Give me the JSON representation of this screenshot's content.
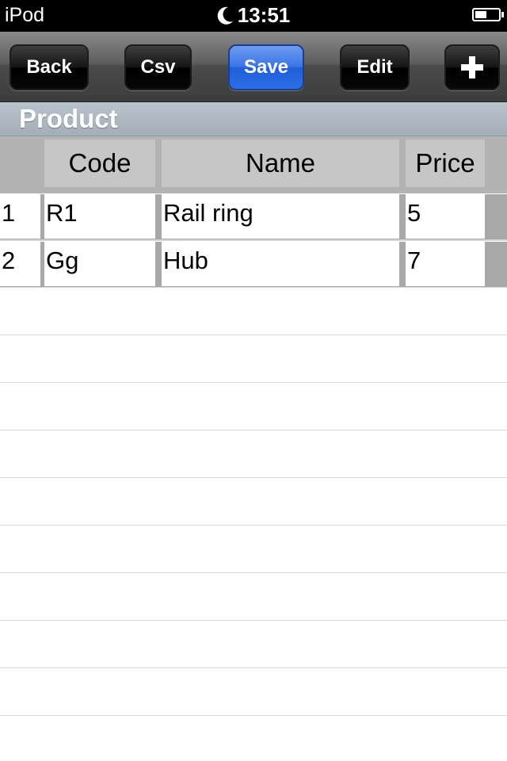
{
  "status_bar": {
    "carrier": "iPod",
    "time": "13:51",
    "battery_level": 0.5
  },
  "toolbar": {
    "back_label": "Back",
    "csv_label": "Csv",
    "save_label": "Save",
    "edit_label": "Edit",
    "add_icon": "plus-icon"
  },
  "section": {
    "title": "Product"
  },
  "table": {
    "columns": [
      "Code",
      "Name",
      "Price"
    ],
    "rows": [
      {
        "index": "1",
        "code": "R1",
        "name": "Rail ring",
        "price": "5"
      },
      {
        "index": "2",
        "code": "Gg",
        "name": "Hub",
        "price": "7"
      }
    ]
  },
  "colors": {
    "save_button": "#2d6fe6",
    "header_band": "#aeb8c2"
  }
}
